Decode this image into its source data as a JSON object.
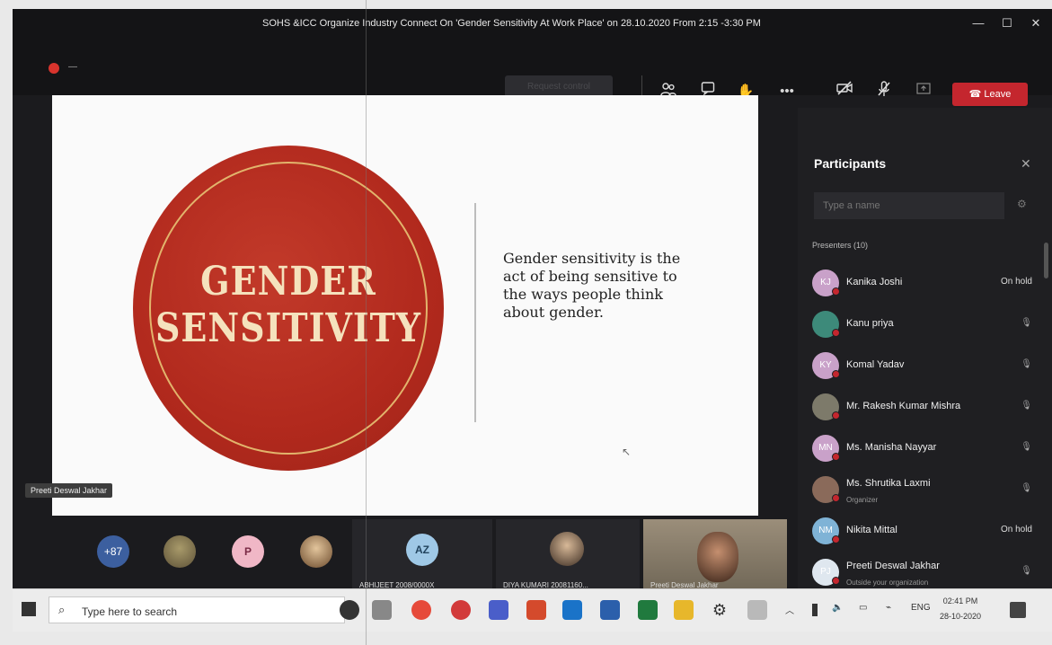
{
  "window": {
    "title": "SOHS &ICC Organize Industry Connect On 'Gender Sensitivity At Work Place' on 28.10.2020 From 2:15 -3:30 PM",
    "minimize": "—",
    "maximize": "☐",
    "close": "✕"
  },
  "toolbar": {
    "timer": "—",
    "request_control": "Request control",
    "icons": [
      "people-icon",
      "chat-icon",
      "raise-hand-icon",
      "more-icon",
      "camera-off-icon",
      "mic-off-icon",
      "share-icon"
    ],
    "leave_label": "Leave"
  },
  "slide": {
    "circle_line1": "GENDER",
    "circle_line2": "SENSITIVITY",
    "quote": "Gender sensitivity is the act of being sensitive to the ways people think about gender.",
    "circle_color": "#b1291d",
    "ring_color": "#e2b46c"
  },
  "presenter_tag": "Preeti Deswal Jakhar",
  "strip": {
    "more_count": "+87",
    "p_initial": "P",
    "az_initials": "AZ",
    "tiles": [
      {
        "name": "ABHIJEET 2008/0000X"
      },
      {
        "name": "DIYA KUMARI 20081160..."
      },
      {
        "name": "Preeti Deswal Jakhar"
      }
    ]
  },
  "panel": {
    "title": "Participants",
    "close": "✕",
    "search_placeholder": "Type a name",
    "group_label": "Presenters (10)",
    "participants": [
      {
        "initials": "KJ",
        "name": "Kanika Joshi",
        "right": "On hold",
        "color": "#c9a1c9"
      },
      {
        "initials": "",
        "name": "Kanu priya",
        "right": "",
        "color": "#3d8a7a"
      },
      {
        "initials": "KY",
        "name": "Komal Yadav",
        "right": "",
        "color": "#c9a1c9"
      },
      {
        "initials": "",
        "name": "Mr. Rakesh Kumar Mishra",
        "right": "",
        "color": "#7d7a6a"
      },
      {
        "initials": "MN",
        "name": "Ms. Manisha Nayyar",
        "right": "",
        "color": "#c9a1c9"
      },
      {
        "initials": "",
        "name": "Ms. Shrutika Laxmi",
        "sub": "Organizer",
        "right": "",
        "color": "#8a6a5a"
      },
      {
        "initials": "NM",
        "name": "Nikita Mittal",
        "right": "On hold",
        "color": "#7fb3d6"
      },
      {
        "initials": "PJ",
        "name": "Preeti Deswal Jakhar",
        "sub": "Outside your organization",
        "right": "",
        "color": "#dfe7ef"
      }
    ]
  },
  "taskbar": {
    "search_placeholder": "Type here to search",
    "lang": "ENG",
    "time": "02:41 PM",
    "date": "28-10-2020"
  }
}
